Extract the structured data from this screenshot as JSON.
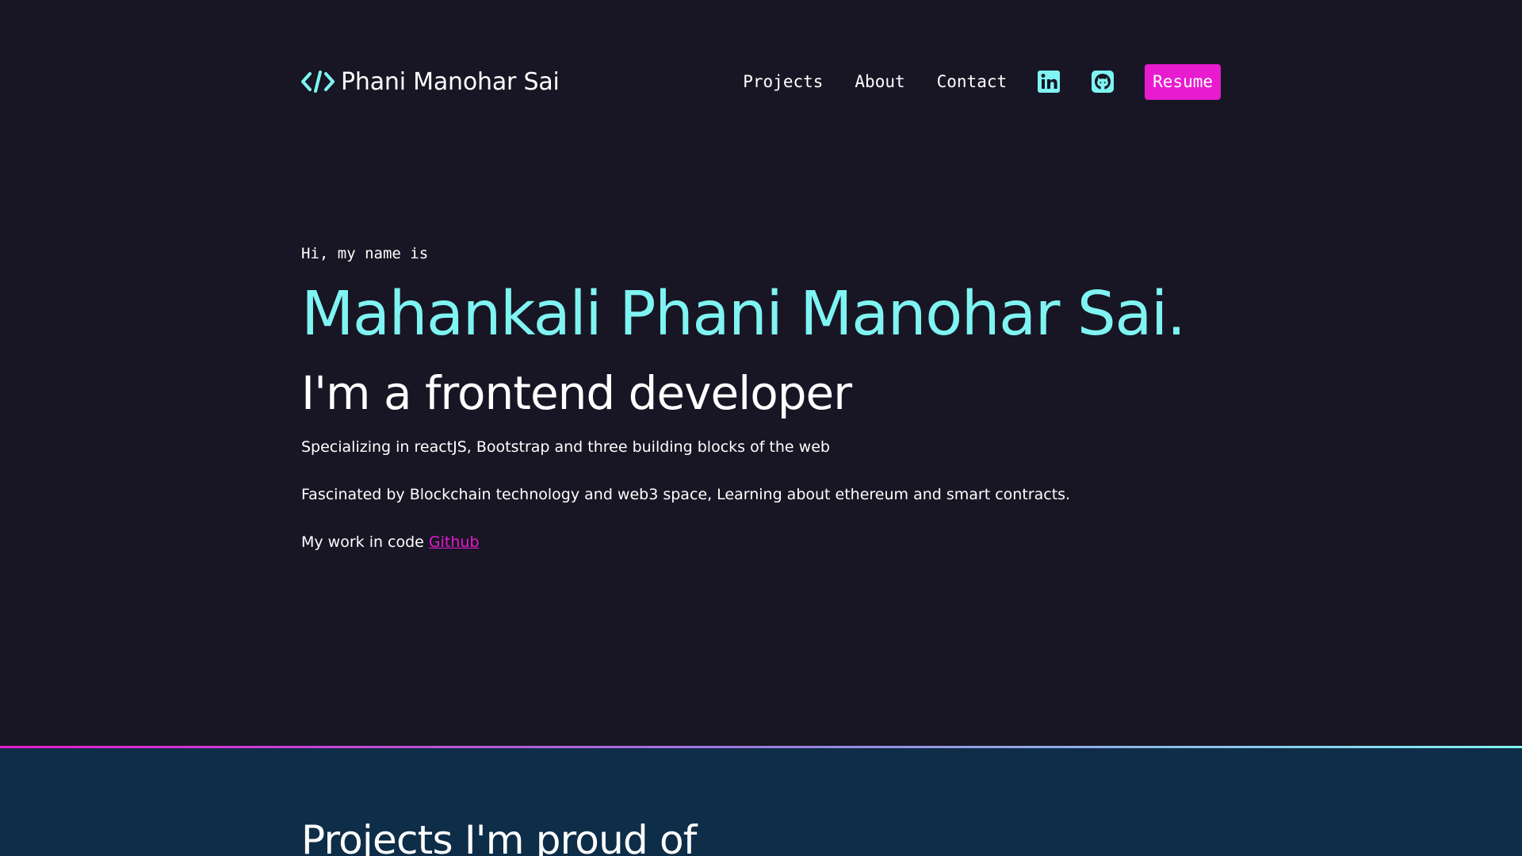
{
  "colors": {
    "background": "#181624",
    "accent_cyan": "#7ff4f2",
    "accent_magenta": "#e81bcf",
    "section_background": "#0e2d48"
  },
  "header": {
    "brand_icon": "code-brackets-icon",
    "brand_name": "Phani Manohar Sai",
    "nav": [
      {
        "label": "Projects"
      },
      {
        "label": "About"
      },
      {
        "label": "Contact"
      }
    ],
    "social_icons": [
      "linkedin-icon",
      "github-icon"
    ],
    "resume_label": "Resume"
  },
  "hero": {
    "greeting": "Hi, my name is",
    "name": "Mahankali Phani Manohar Sai.",
    "role": "I'm a frontend developer",
    "paragraph1": "Specializing in reactJS, Bootstrap and three building blocks of the web",
    "paragraph2": "Fascinated by Blockchain technology and web3 space, Learning about ethereum and smart contracts.",
    "paragraph3_prefix": "My work in code ",
    "paragraph3_link": "Github"
  },
  "projects": {
    "title": "Projects I'm proud of"
  }
}
